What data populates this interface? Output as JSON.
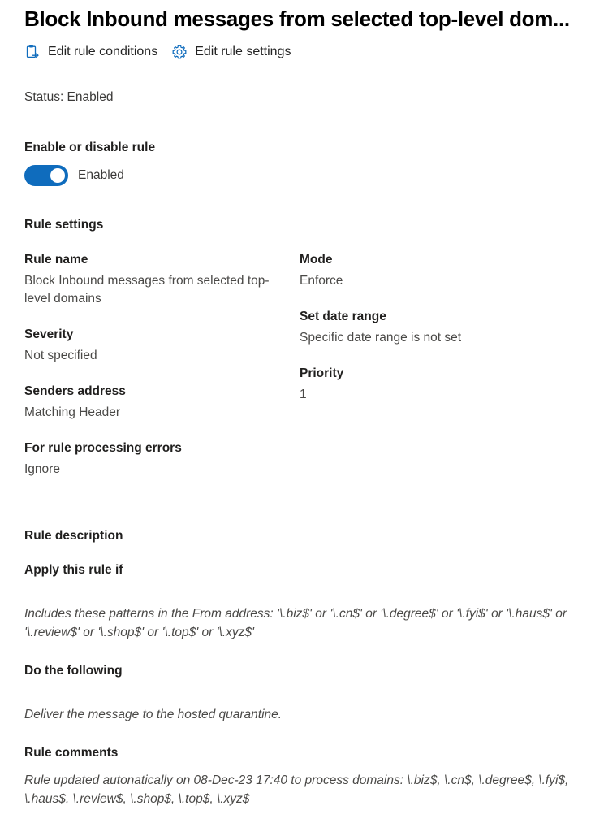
{
  "header": {
    "title": "Block Inbound messages from selected top-level dom...",
    "commands": [
      {
        "icon": "clipboard-arrow-icon",
        "label": "Edit rule conditions"
      },
      {
        "icon": "gear-icon",
        "label": "Edit rule settings"
      }
    ]
  },
  "status": {
    "text": "Status: Enabled"
  },
  "enable_section": {
    "label": "Enable or disable rule",
    "toggle_state_label": "Enabled",
    "toggle_on": true,
    "accent_color": "#0f6cbd"
  },
  "rule_settings": {
    "heading": "Rule settings",
    "left_column": [
      {
        "label": "Rule name",
        "value": "Block Inbound messages from selected top-level domains"
      },
      {
        "label": "Severity",
        "value": "Not specified"
      },
      {
        "label": "Senders address",
        "value": "Matching Header"
      },
      {
        "label": "For rule processing errors",
        "value": "Ignore"
      }
    ],
    "right_column": [
      {
        "label": "Mode",
        "value": "Enforce"
      },
      {
        "label": "Set date range",
        "value": "Specific date range is not set"
      },
      {
        "label": "Priority",
        "value": "1"
      }
    ]
  },
  "rule_description": {
    "heading": "Rule description",
    "apply_heading": "Apply this rule if",
    "apply_text": "Includes these patterns in the From address: '\\.biz$' or '\\.cn$' or '\\.degree$' or '\\.fyi$' or '\\.haus$' or '\\.review$' or '\\.shop$' or '\\.top$' or '\\.xyz$'",
    "do_heading": "Do the following",
    "do_text": "Deliver the message to the hosted quarantine.",
    "comments_heading": "Rule comments",
    "comments_text": "Rule updated autonatically on 08-Dec-23 17:40 to process domains: \\.biz$, \\.cn$, \\.degree$, \\.fyi$, \\.haus$, \\.review$, \\.shop$, \\.top$, \\.xyz$"
  }
}
